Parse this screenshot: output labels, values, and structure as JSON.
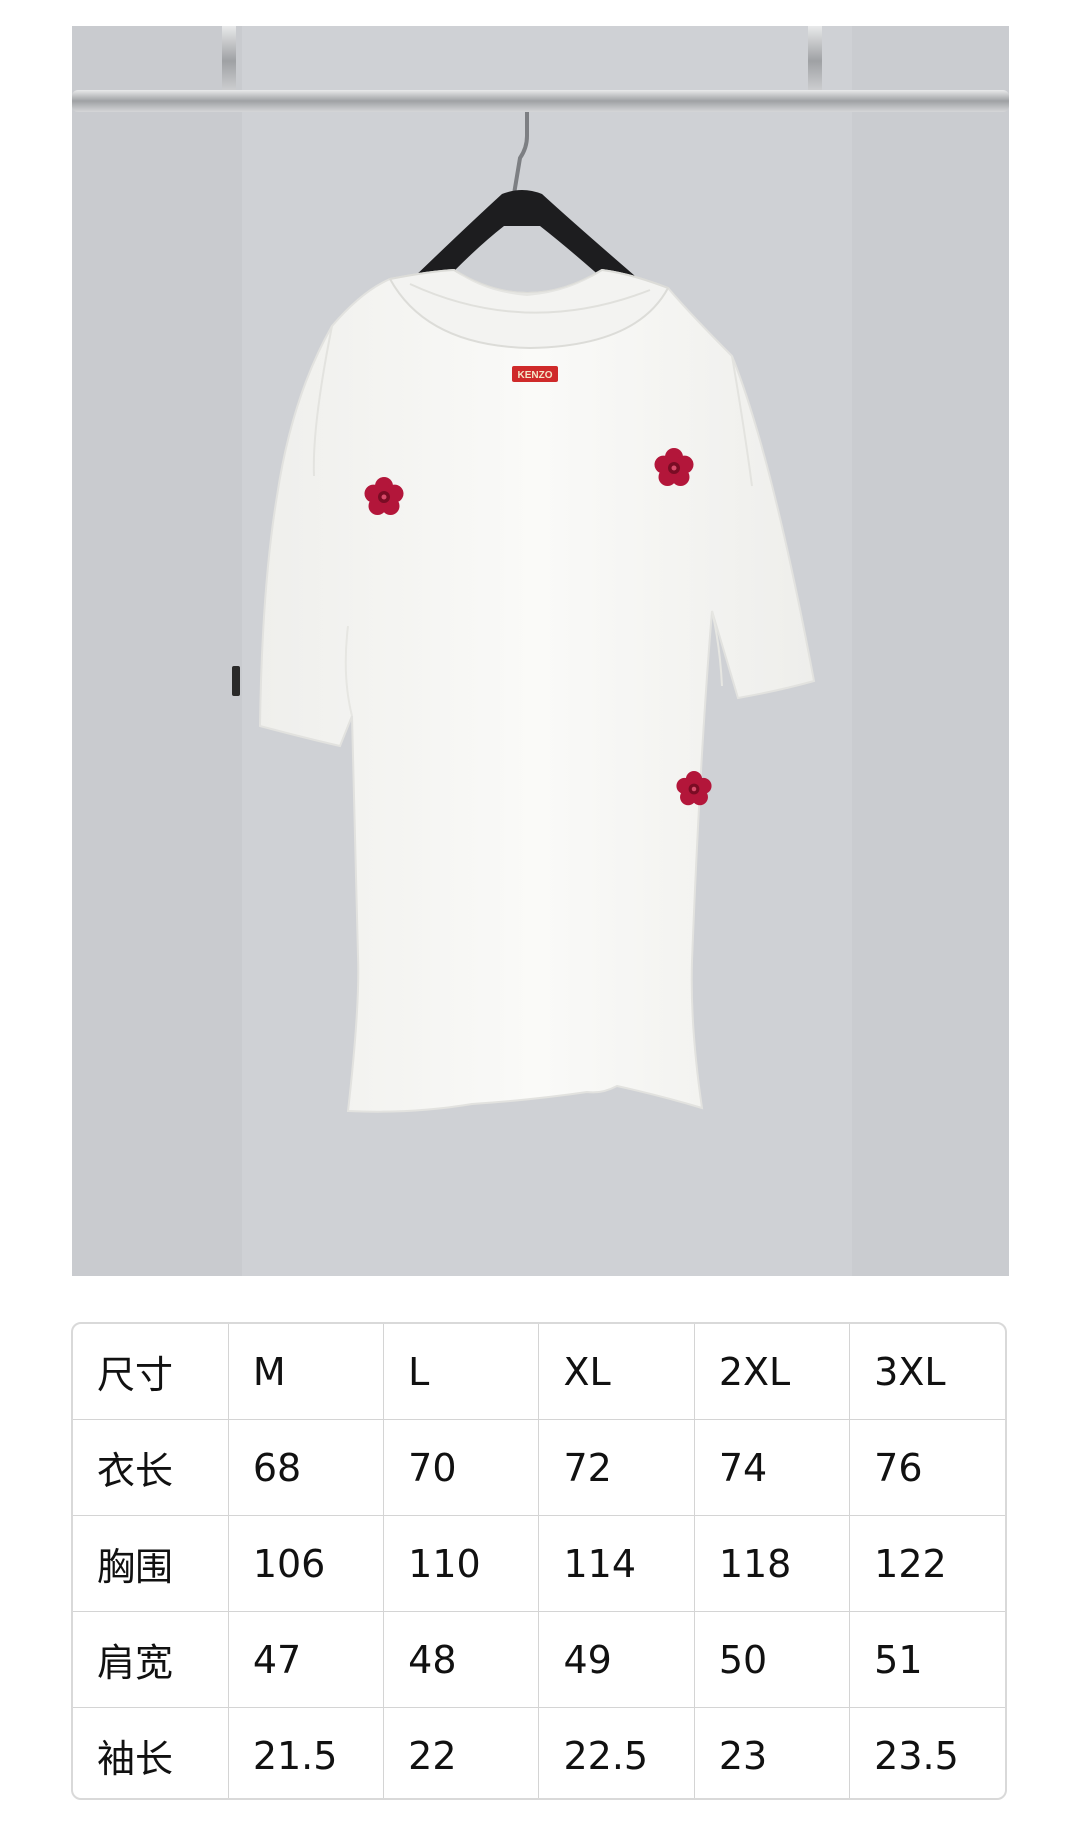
{
  "photo": {
    "label_text": "KENZO",
    "colors": {
      "wall": "#cfd1d5",
      "shirt": "#f7f7f5",
      "rail": "#b7b8ba",
      "hanger": "#1d1d1f",
      "flower": "#b3163a",
      "label": "#cf2a2a"
    }
  },
  "size_table": {
    "rows": [
      {
        "label": "尺寸",
        "values": [
          "M",
          "L",
          "XL",
          "2XL",
          "3XL"
        ]
      },
      {
        "label": "衣长",
        "values": [
          "68",
          "70",
          "72",
          "74",
          "76"
        ]
      },
      {
        "label": "胸围",
        "values": [
          "106",
          "110",
          "114",
          "118",
          "122"
        ]
      },
      {
        "label": "肩宽",
        "values": [
          "47",
          "48",
          "49",
          "50",
          "51"
        ]
      },
      {
        "label": "袖长",
        "values": [
          "21.5",
          "22",
          "22.5",
          "23",
          "23.5"
        ]
      }
    ]
  }
}
